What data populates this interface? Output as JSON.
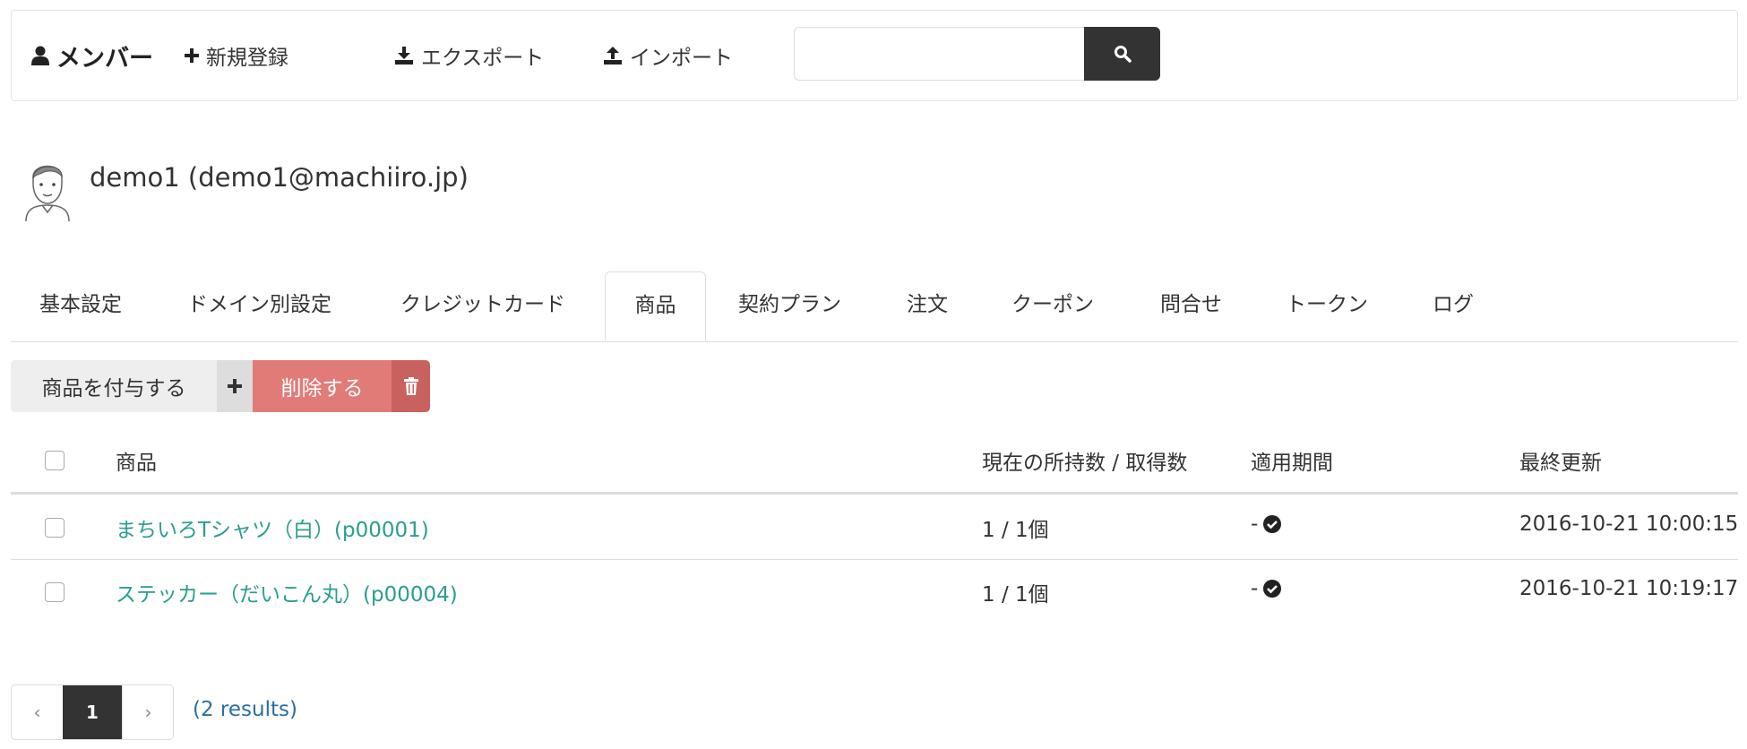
{
  "navbar": {
    "brand": "メンバー",
    "new_label": "新規登録",
    "export_label": "エクスポート",
    "import_label": "インポート",
    "search_value": ""
  },
  "user": {
    "title": "demo1 (demo1@machiiro.jp)"
  },
  "tabs": [
    {
      "label": "基本設定"
    },
    {
      "label": "ドメイン別設定"
    },
    {
      "label": "クレジットカード"
    },
    {
      "label": "商品",
      "active": true
    },
    {
      "label": "契約プラン"
    },
    {
      "label": "注文"
    },
    {
      "label": "クーポン"
    },
    {
      "label": "問合せ"
    },
    {
      "label": "トークン"
    },
    {
      "label": "ログ"
    }
  ],
  "actions": {
    "grant_label": "商品を付与する",
    "delete_label": "削除する"
  },
  "table": {
    "headers": {
      "product": "商品",
      "count": "現在の所持数 / 取得数",
      "period": "適用期間",
      "updated": "最終更新"
    },
    "rows": [
      {
        "product": "まちいろTシャツ（白）(p00001)",
        "count": "1 / 1個",
        "period": "-",
        "updated": "2016-10-21 10:00:15"
      },
      {
        "product": "ステッカー（だいこん丸）(p00004)",
        "count": "1 / 1個",
        "period": "-",
        "updated": "2016-10-21 10:19:17"
      }
    ]
  },
  "pagination": {
    "prev": "‹",
    "current": "1",
    "next": "›",
    "results": "(2 results)"
  },
  "colors": {
    "link": "#2a9d8f",
    "danger": "#e07b78",
    "dark": "#333333"
  }
}
